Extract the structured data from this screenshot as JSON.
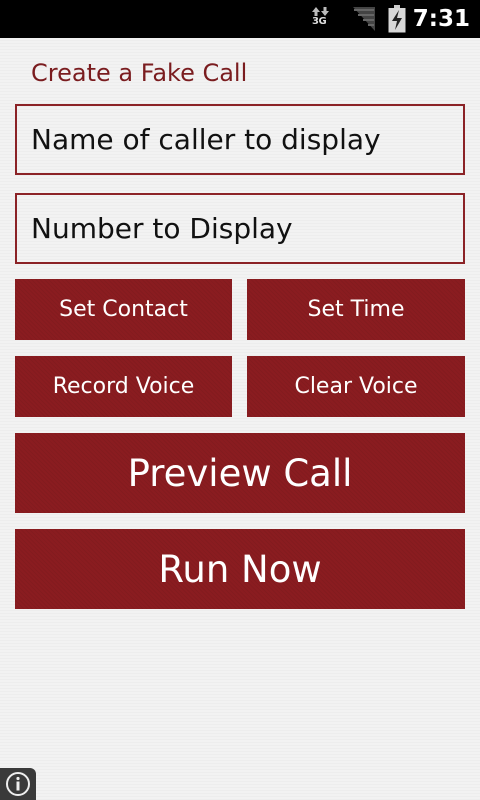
{
  "status_bar": {
    "network_type": "3G",
    "time": "7:31"
  },
  "screen": {
    "title": "Create a Fake Call"
  },
  "form": {
    "caller_name_placeholder": "Name of caller to display",
    "caller_name_value": "",
    "caller_number_placeholder": "Number to Display",
    "caller_number_value": ""
  },
  "buttons": {
    "set_contact": "Set Contact",
    "set_time": "Set Time",
    "record_voice": "Record Voice",
    "clear_voice": "Clear Voice",
    "preview_call": "Preview Call",
    "run_now": "Run Now"
  },
  "icons": {
    "network": "data-arrows-icon",
    "signal": "signal-strength-icon",
    "battery": "battery-charging-icon",
    "info": "info-icon"
  },
  "colors": {
    "accent": "#8a1c20",
    "title_text": "#7a1c1f",
    "background": "#f2f2f2",
    "status_bar": "#000000"
  }
}
